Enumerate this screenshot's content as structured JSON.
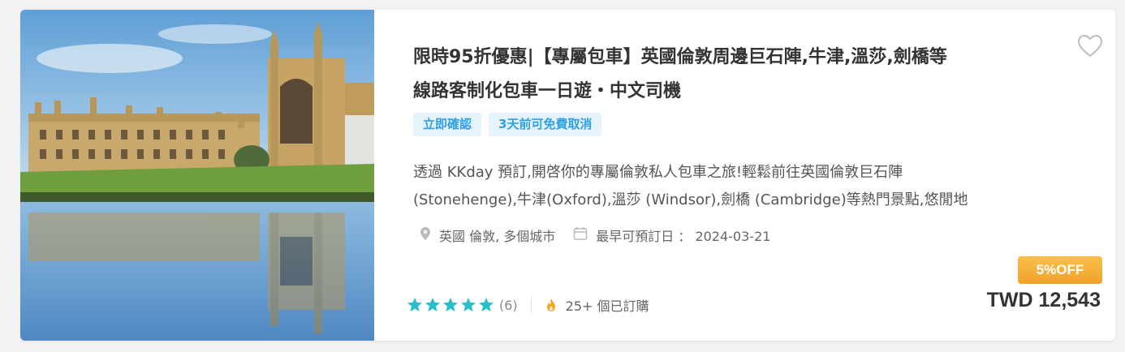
{
  "product": {
    "title_line1": "限時95折優惠|【專屬包車】英國倫敦周邊巨石陣,牛津,溫莎,劍橋等",
    "title_line2": "線路客制化包車一日遊・中文司機",
    "tags": [
      "立即確認",
      "3天前可免費取消"
    ],
    "desc_line1": "透過 KKday 預訂,開啓你的專屬倫敦私人包車之旅!輕鬆前往英國倫敦巨石陣",
    "desc_line2": "(Stonehenge),牛津(Oxford),溫莎 (Windsor),劍橋 (Cambridge)等熱門景點,悠閒地",
    "location": "英國 倫敦, 多個城市",
    "earliest_date": "最早可預訂日 ： 2024-03-21",
    "rating_count": "(6)",
    "booked": "25+ 個已訂購",
    "discount_badge": "5%OFF",
    "price": "TWD 12,543",
    "rating_stars": 5
  },
  "icons": {
    "favorite": "heart-outline-icon",
    "location": "map-pin-icon",
    "date": "calendar-icon",
    "popular": "flame-icon",
    "star": "star-icon"
  },
  "colors": {
    "tag_text": "#2da0e6",
    "tag_bg": "#e5f3fb",
    "star": "#26bec9",
    "badge": "#f0a22a"
  }
}
